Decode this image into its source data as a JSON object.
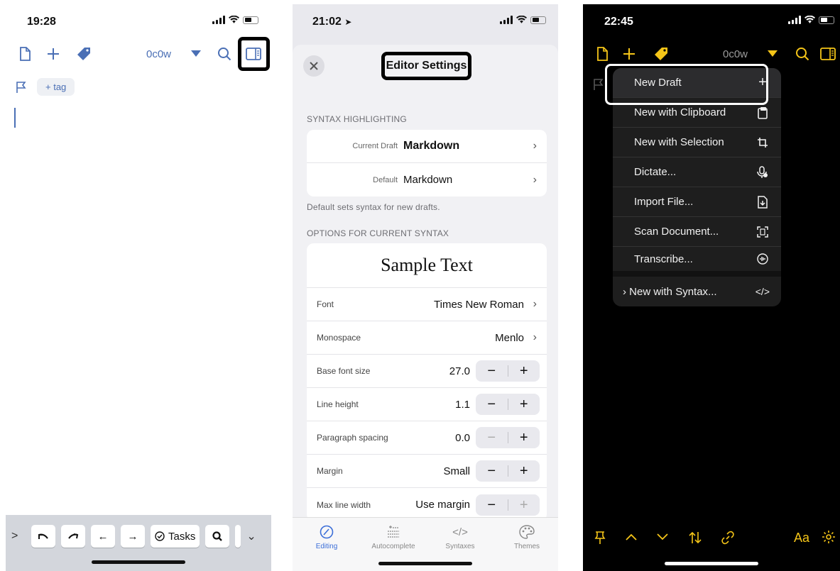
{
  "panel1": {
    "status_time": "19:28",
    "counter": "0c0w",
    "tag_button": "+ tag",
    "keyboard_toolbar": {
      "tasks_label": "Tasks"
    }
  },
  "panel2": {
    "status_time": "21:02",
    "title": "Editor Settings",
    "section_syntax": "SYNTAX HIGHLIGHTING",
    "current_draft_label": "Current Draft",
    "current_draft_value": "Markdown",
    "default_label": "Default",
    "default_value": "Markdown",
    "footnote": "Default sets syntax for new drafts.",
    "section_options": "OPTIONS FOR CURRENT SYNTAX",
    "sample_text": "Sample Text",
    "rows": [
      {
        "label": "Font",
        "value": "Times New Roman"
      },
      {
        "label": "Monospace",
        "value": "Menlo"
      },
      {
        "label": "Base font size",
        "value": "27.0"
      },
      {
        "label": "Line height",
        "value": "1.1"
      },
      {
        "label": "Paragraph spacing",
        "value": "0.0"
      },
      {
        "label": "Margin",
        "value": "Small"
      },
      {
        "label": "Max line width",
        "value": "Use margin"
      }
    ],
    "tabs": [
      {
        "label": "Editing"
      },
      {
        "label": "Autocomplete"
      },
      {
        "label": "Syntaxes"
      },
      {
        "label": "Themes"
      }
    ]
  },
  "panel3": {
    "status_time": "22:45",
    "counter": "0c0w",
    "menu": [
      {
        "label": "New Draft",
        "icon": "+"
      },
      {
        "label": "New with Clipboard",
        "icon": "clipboard-icon"
      },
      {
        "label": "New with Selection",
        "icon": "crop-icon"
      },
      {
        "label": "Dictate...",
        "icon": "mic-icon"
      },
      {
        "label": "Import File...",
        "icon": "import-icon"
      },
      {
        "label": "Scan Document...",
        "icon": "scan-icon"
      },
      {
        "label": "Transcribe...",
        "icon": "waveform-icon"
      },
      {
        "label": "New with Syntax...",
        "icon": "code-icon"
      }
    ],
    "aa_label": "Aa"
  },
  "colors": {
    "accent_blue": "#4a6fb5",
    "accent_yellow": "#f5c518",
    "tab_active": "#3b6ed8"
  }
}
